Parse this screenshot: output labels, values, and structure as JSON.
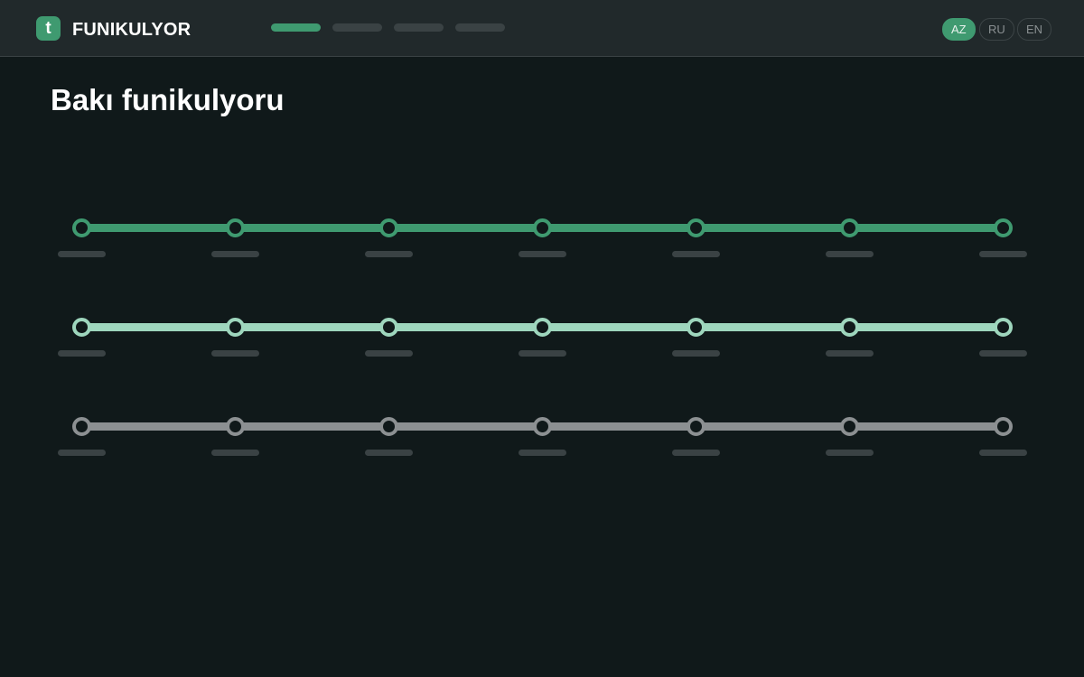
{
  "header": {
    "logo_letter": "t",
    "brand": "FUNIKULYOR",
    "nav_items": [
      {
        "name": "nav-item-1",
        "active": true
      },
      {
        "name": "nav-item-2",
        "active": false
      },
      {
        "name": "nav-item-3",
        "active": false
      },
      {
        "name": "nav-item-4",
        "active": false
      }
    ],
    "languages": [
      {
        "code": "AZ",
        "active": true
      },
      {
        "code": "RU",
        "active": false
      },
      {
        "code": "EN",
        "active": false
      }
    ]
  },
  "main": {
    "title": "Bakı funikulyoru"
  },
  "lines": [
    {
      "name": "line-1",
      "color": "#3f9a70",
      "stations": 7
    },
    {
      "name": "line-2",
      "color": "#9ed6bd",
      "stations": 7
    },
    {
      "name": "line-3",
      "color": "#8c9092",
      "stations": 7
    }
  ],
  "colors": {
    "background": "#10191a",
    "header": "#21292b",
    "accent": "#3f9a70",
    "placeholder": "#3a4244"
  }
}
